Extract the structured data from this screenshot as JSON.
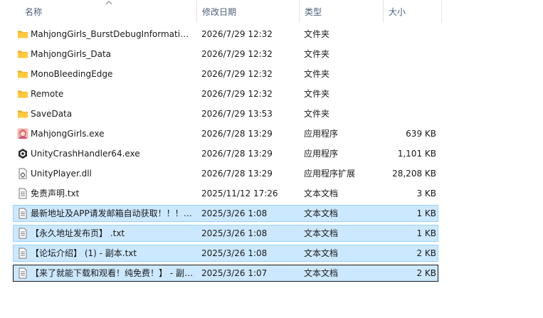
{
  "header": {
    "name": "名称",
    "date": "修改日期",
    "type": "类型",
    "size": "大小"
  },
  "files": [
    {
      "name": "MahjongGirls_BurstDebugInformation_DoNotShip",
      "date": "2026/7/29 12:32",
      "type": "文件夹",
      "size": "",
      "icon": "folder-icon",
      "selected": false
    },
    {
      "name": "MahjongGirls_Data",
      "date": "2026/7/29 12:32",
      "type": "文件夹",
      "size": "",
      "icon": "folder-icon",
      "selected": false
    },
    {
      "name": "MonoBleedingEdge",
      "date": "2026/7/29 12:32",
      "type": "文件夹",
      "size": "",
      "icon": "folder-icon",
      "selected": false
    },
    {
      "name": "Remote",
      "date": "2026/7/29 12:32",
      "type": "文件夹",
      "size": "",
      "icon": "folder-icon",
      "selected": false
    },
    {
      "name": "SaveData",
      "date": "2026/7/29 13:53",
      "type": "文件夹",
      "size": "",
      "icon": "folder-icon",
      "selected": false
    },
    {
      "name": "MahjongGirls.exe",
      "date": "2026/7/28 13:29",
      "type": "应用程序",
      "size": "639 KB",
      "icon": "game-app-icon",
      "selected": false
    },
    {
      "name": "UnityCrashHandler64.exe",
      "date": "2026/7/28 13:29",
      "type": "应用程序",
      "size": "1,101 KB",
      "icon": "unity-app-icon",
      "selected": false
    },
    {
      "name": "UnityPlayer.dll",
      "date": "2026/7/28 13:29",
      "type": "应用程序扩展",
      "size": "28,208 KB",
      "icon": "dll-file-icon",
      "selected": false
    },
    {
      "name": "免责声明.txt",
      "date": "2025/11/12 17:26",
      "type": "文本文档",
      "size": "3 KB",
      "icon": "text-file-icon",
      "selected": false
    },
    {
      "name": "最新地址及APP请发邮箱自动获取！！！.txt",
      "date": "2025/3/26 1:08",
      "type": "文本文档",
      "size": "1 KB",
      "icon": "text-file-icon",
      "selected": true
    },
    {
      "name": "【永久地址发布页】 .txt",
      "date": "2025/3/26 1:08",
      "type": "文本文档",
      "size": "1 KB",
      "icon": "text-file-icon",
      "selected": true
    },
    {
      "name": "【论坛介绍】 (1) - 副本.txt",
      "date": "2025/3/26 1:08",
      "type": "文本文档",
      "size": "2 KB",
      "icon": "text-file-icon",
      "selected": true
    },
    {
      "name": "【来了就能下载和观看！纯免费！】 - 副本.txt",
      "date": "2025/3/26 1:07",
      "type": "文本文档",
      "size": "2 KB",
      "icon": "text-file-icon",
      "selected": true,
      "focused": true
    }
  ],
  "colors": {
    "header_text": "#4c607a",
    "selection_bg": "#cce8ff",
    "selection_border": "#99d1ff",
    "folder_yellow": "#ffc83d"
  }
}
